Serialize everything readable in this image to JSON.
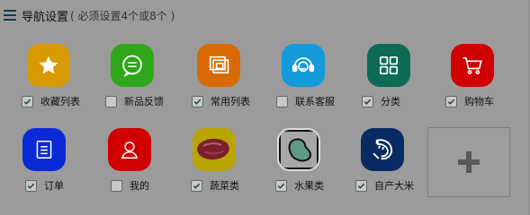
{
  "header": {
    "title": "导航设置",
    "subtitle": "( 必须设置4个或8个 )"
  },
  "nav_items": [
    {
      "label": "收藏列表",
      "checked": true,
      "icon": "star-icon",
      "color": "#d79a00"
    },
    {
      "label": "新品反馈",
      "checked": false,
      "icon": "chat-bubble-icon",
      "color": "#2ea81a"
    },
    {
      "label": "常用列表",
      "checked": true,
      "icon": "stacked-frames-icon",
      "color": "#d86a00"
    },
    {
      "label": "联系客服",
      "checked": false,
      "icon": "headset-icon",
      "color": "#139ad8"
    },
    {
      "label": "分类",
      "checked": true,
      "icon": "grid-icon",
      "color": "#0d6b55"
    },
    {
      "label": "购物车",
      "checked": true,
      "icon": "shopping-cart-icon",
      "color": "#d00000"
    },
    {
      "label": "订单",
      "checked": true,
      "icon": "document-icon",
      "color": "#0a2ad8"
    },
    {
      "label": "我的",
      "checked": false,
      "icon": "person-icon",
      "color": "#d00000"
    },
    {
      "label": "蔬菜类",
      "checked": true,
      "icon": "meat-photo-icon",
      "color": "#b9a400"
    },
    {
      "label": "水果类",
      "checked": true,
      "icon": "bean-icon",
      "color": "#111111"
    },
    {
      "label": "自产大米",
      "checked": true,
      "icon": "shrimp-icon",
      "color": "#0a2a63"
    }
  ],
  "add_button": {
    "icon": "plus-icon"
  }
}
